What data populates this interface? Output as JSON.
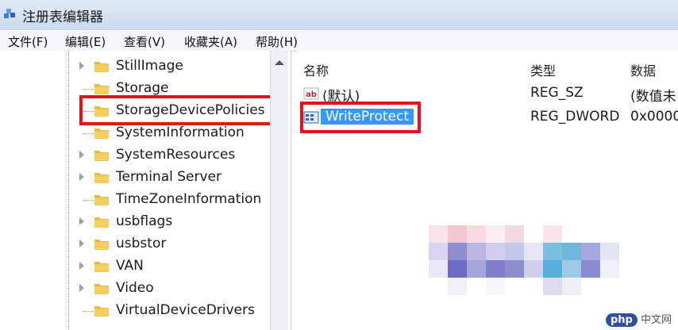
{
  "window": {
    "title": "注册表编辑器"
  },
  "menu": [
    "文件(F)",
    "编辑(E)",
    "查看(V)",
    "收藏夹(A)",
    "帮助(H)"
  ],
  "tree": {
    "items": [
      {
        "label": "StillImage",
        "expander": true
      },
      {
        "label": "Storage",
        "expander": false
      },
      {
        "label": "StorageDevicePolicies",
        "expander": false,
        "highlighted": true
      },
      {
        "label": "SystemInformation",
        "expander": false
      },
      {
        "label": "SystemResources",
        "expander": true
      },
      {
        "label": "Terminal Server",
        "expander": true
      },
      {
        "label": "TimeZoneInformation",
        "expander": false
      },
      {
        "label": "usbflags",
        "expander": true
      },
      {
        "label": "usbstor",
        "expander": true
      },
      {
        "label": "VAN",
        "expander": true
      },
      {
        "label": "Video",
        "expander": true
      },
      {
        "label": "VirtualDeviceDrivers",
        "expander": false
      }
    ]
  },
  "values": {
    "columns": [
      "名称",
      "类型",
      "数据"
    ],
    "rows": [
      {
        "name": "(默认)",
        "type": "REG_SZ",
        "data": "(数值未",
        "icon": "string-value-icon"
      },
      {
        "name": "WriteProtect",
        "type": "REG_DWORD",
        "data": "0x0000",
        "icon": "dword-value-icon",
        "selected": true
      }
    ]
  },
  "watermark": {
    "brand": "php",
    "text": "中文网"
  },
  "colors": {
    "highlight_border": "#e1151b",
    "selection": "#3399ff",
    "folder": "#e8b83a"
  }
}
